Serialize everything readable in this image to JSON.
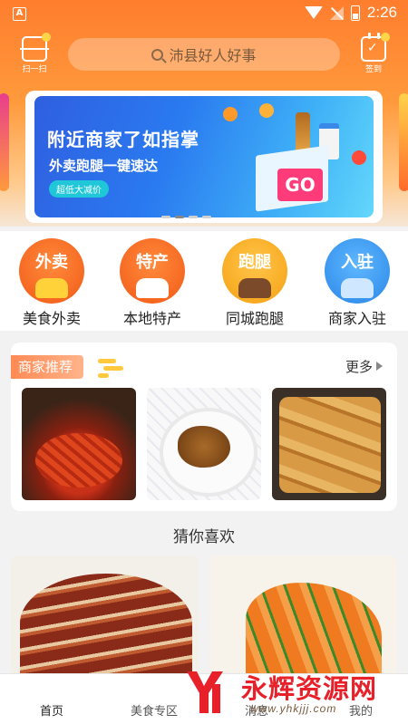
{
  "status_bar": {
    "app_badge": "A",
    "time": "2:26"
  },
  "header": {
    "scan_label": "扫一扫",
    "checkin_label": "签到",
    "search_placeholder": "沛县好人好事"
  },
  "banner": {
    "title": "附近商家了如指掌",
    "subtitle": "外卖跑腿一键速达",
    "badge": "超低大减价",
    "go": "GO",
    "active_slide": 2,
    "slide_count": 4
  },
  "categories": [
    {
      "icon_text": "外卖",
      "label": "美食外卖",
      "icon": "takeout-icon"
    },
    {
      "icon_text": "特产",
      "label": "本地特产",
      "icon": "specialty-icon"
    },
    {
      "icon_text": "跑腿",
      "label": "同城跑腿",
      "icon": "errand-icon"
    },
    {
      "icon_text": "入驻",
      "label": "商家入驻",
      "icon": "merchant-join-icon"
    }
  ],
  "recommend": {
    "title": "商家推荐",
    "more": "更多",
    "items": [
      "crawfish-photo",
      "braised-dish-photo",
      "tofu-rolls-photo"
    ]
  },
  "guess": {
    "title": "猜你喜欢",
    "items": [
      "braised-pork-photo",
      "stir-fry-tripe-photo"
    ]
  },
  "tabbar": {
    "home": "首页",
    "food": "美食专区",
    "messages": "消息",
    "mine": "我的"
  },
  "watermark": {
    "brand": "永辉资源网",
    "url": "www.yhkjjj.com"
  },
  "colors": {
    "header_orange": "#ff7d2e",
    "accent_red": "#e8202a",
    "banner_blue": "#2a7af0"
  }
}
